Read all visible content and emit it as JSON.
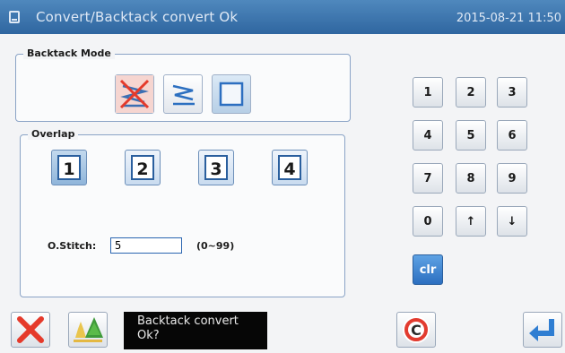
{
  "window": {
    "title": "Convert/Backtack convert Ok",
    "datetime": "2015-08-21 11:50"
  },
  "backtack_mode": {
    "legend": "Backtack Mode",
    "options": [
      {
        "icon": "backtack-off-icon",
        "selected": false
      },
      {
        "icon": "backtack-zigzag-icon",
        "selected": false
      },
      {
        "icon": "backtack-plain-icon",
        "selected": true
      }
    ]
  },
  "overlap": {
    "legend": "Overlap",
    "options": [
      {
        "label": "1",
        "selected": true
      },
      {
        "label": "2",
        "selected": false
      },
      {
        "label": "3",
        "selected": false
      },
      {
        "label": "4",
        "selected": false
      }
    ],
    "stitch_label": "O.Stitch:",
    "stitch_value": "5",
    "stitch_range": "(0~99)"
  },
  "keypad": {
    "keys": [
      "1",
      "2",
      "3",
      "4",
      "5",
      "6",
      "7",
      "8",
      "9",
      "0",
      "↑",
      "↓"
    ],
    "clear": "clr"
  },
  "footer": {
    "message_line1": "Backtack convert",
    "message_line2": "Ok?",
    "icons": [
      "cancel-icon",
      "trees-icon",
      "copyright-c-icon",
      "enter-icon"
    ]
  },
  "colors": {
    "titlebar": "#3a74ad",
    "accent": "#2c6fc0",
    "cancel": "#e53a2b"
  }
}
